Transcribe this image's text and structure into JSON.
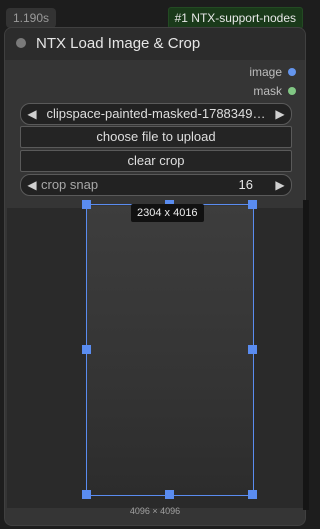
{
  "status": {
    "timing": "1.190s",
    "node_id_badge": "#1 NTX-support-nodes"
  },
  "node": {
    "title": "NTX Load Image & Crop",
    "outputs": [
      {
        "label": "image",
        "color": "#6495ed"
      },
      {
        "label": "mask",
        "color": "#81c784"
      }
    ],
    "widgets": {
      "image_combo": {
        "value": "clipspace-painted-masked-1788349…",
        "prev": "◀",
        "next": "▶"
      },
      "upload_button": "choose file to upload",
      "clear_crop_button": "clear crop",
      "crop_snap": {
        "label": "crop snap",
        "value": "16",
        "prev": "◀",
        "next": "▶"
      }
    },
    "preview": {
      "crop_size": "2304 x 4016",
      "image_size": "4096 × 4096"
    }
  },
  "colors": {
    "crop_accent": "#5a8cf0",
    "badge_bg": "#1a3a1a"
  }
}
